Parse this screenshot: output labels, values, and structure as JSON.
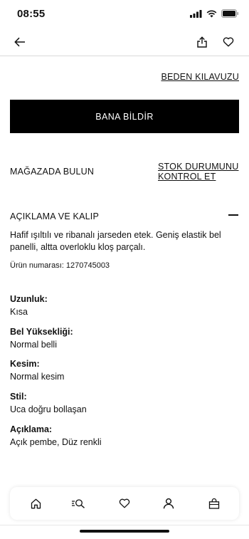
{
  "status_bar": {
    "time": "08:55"
  },
  "header": {
    "back_icon": "arrow-left-icon",
    "share_icon": "share-icon",
    "favorite_icon": "heart-icon"
  },
  "size_guide_label": "BEDEN KILAVUZU",
  "notify_button_label": "BANA BİLDİR",
  "store": {
    "find_label": "MAĞAZADA BULUN",
    "stock_line1": "STOK DURUMUNU",
    "stock_line2": "KONTROL ET"
  },
  "description_section": {
    "title": "AÇIKLAMA VE KALIP",
    "text": "Hafif ışıltılı ve ribanalı jarseden etek. Geniş elastik bel panelli, altta overloklu kloş parçalı.",
    "product_number_label": "Ürün numarası:",
    "product_number": "1270745003",
    "attributes": [
      {
        "label": "Uzunluk:",
        "value": "Kısa"
      },
      {
        "label": "Bel Yüksekliği:",
        "value": "Normal belli"
      },
      {
        "label": "Kesim:",
        "value": "Normal kesim"
      },
      {
        "label": "Stil:",
        "value": "Uca doğru bollaşan"
      },
      {
        "label": "Açıklama:",
        "value": "Açık pembe, Düz renkli"
      }
    ]
  },
  "tab_bar": [
    "home-icon",
    "search-icon",
    "heart-icon",
    "account-icon",
    "bag-icon"
  ]
}
